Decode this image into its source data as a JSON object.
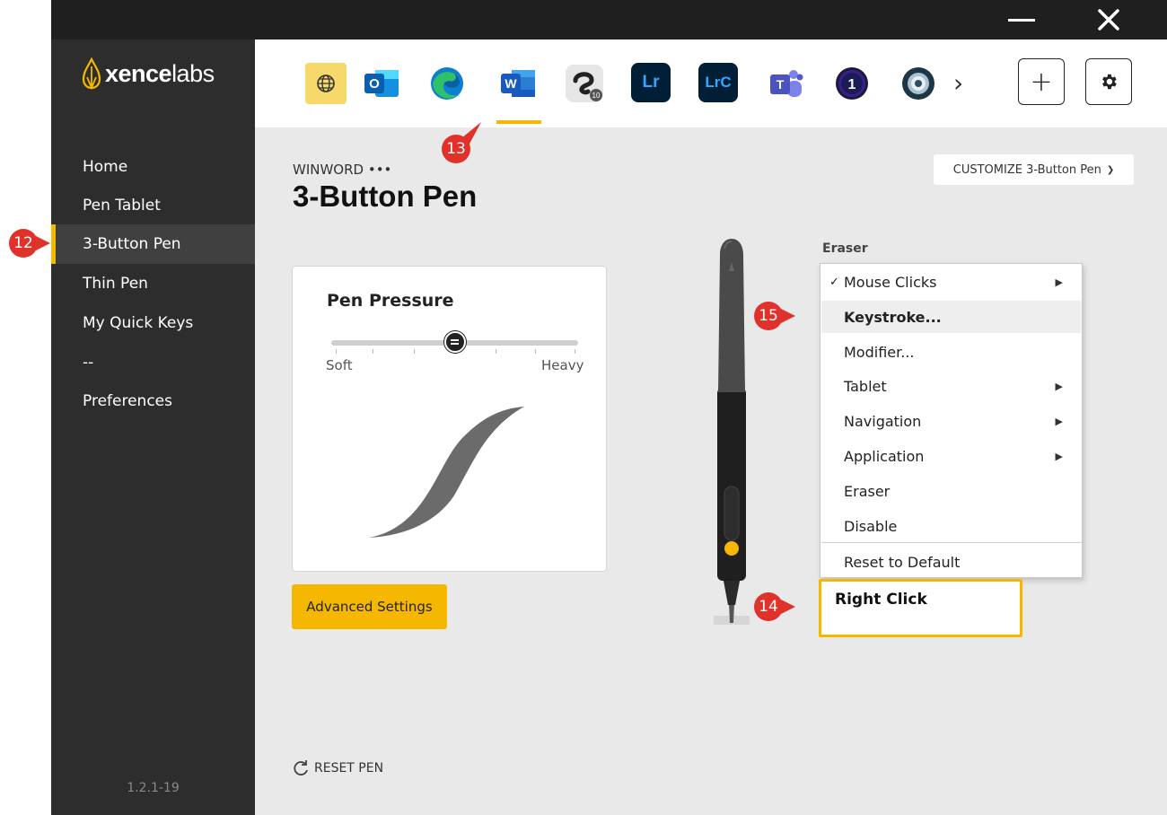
{
  "window": {
    "minimize_icon": "minimize-icon",
    "close_icon": "close-icon"
  },
  "logo": {
    "word_bold": "xence",
    "word_light": "labs",
    "accent": "#f5b700"
  },
  "sidebar": {
    "items": [
      {
        "label": "Home"
      },
      {
        "label": "Pen Tablet"
      },
      {
        "label": "3-Button Pen",
        "active": true
      },
      {
        "label": "Thin Pen"
      },
      {
        "label": "My Quick Keys"
      },
      {
        "label": "--"
      },
      {
        "label": "Preferences"
      }
    ],
    "version": "1.2.1-19"
  },
  "apps": {
    "items": [
      {
        "name": "all-apps",
        "icon": "globe-icon"
      },
      {
        "name": "outlook",
        "icon": "outlook-icon",
        "text": "O"
      },
      {
        "name": "edge",
        "icon": "edge-icon"
      },
      {
        "name": "word",
        "icon": "word-icon",
        "text": "W",
        "selected": true
      },
      {
        "name": "clip-studio",
        "icon": "clip-studio-icon",
        "text": "10"
      },
      {
        "name": "lightroom",
        "icon": "lightroom-icon",
        "text": "Lr"
      },
      {
        "name": "lightroom-classic",
        "icon": "lightroom-classic-icon",
        "text": "LrC"
      },
      {
        "name": "teams",
        "icon": "teams-icon",
        "text": "T"
      },
      {
        "name": "capture-one",
        "icon": "capture-one-icon",
        "text": "1"
      },
      {
        "name": "unknown-app",
        "icon": "eye-app-icon"
      }
    ],
    "next_label": "›",
    "add_label": "+"
  },
  "page": {
    "app_name": "WINWORD •••",
    "title": "3-Button Pen",
    "customize_label": "CUSTOMIZE 3-Button Pen",
    "advanced_label": "Advanced Settings",
    "reset_label": "RESET PEN"
  },
  "pressure": {
    "title": "Pen Pressure",
    "soft_label": "Soft",
    "heavy_label": "Heavy",
    "level": 0.5
  },
  "eraser": {
    "label": "Eraser",
    "menu": [
      {
        "label": "Mouse Clicks",
        "checked": true,
        "submenu": true
      },
      {
        "label": "Keystroke...",
        "hover": true
      },
      {
        "label": "Modifier..."
      },
      {
        "label": "Tablet",
        "submenu": true
      },
      {
        "label": "Navigation",
        "submenu": true
      },
      {
        "label": "Application",
        "submenu": true
      },
      {
        "label": "Eraser"
      },
      {
        "label": "Disable"
      },
      {
        "label": "Reset to Default"
      }
    ]
  },
  "button_assignment": "Right Click",
  "callouts": [
    {
      "num": "12"
    },
    {
      "num": "13"
    },
    {
      "num": "14"
    },
    {
      "num": "15"
    }
  ],
  "colors": {
    "accent": "#f5b700",
    "callout": "#e0312b",
    "sidebar": "#2d2d2d",
    "titlebar": "#1f1f1f"
  }
}
